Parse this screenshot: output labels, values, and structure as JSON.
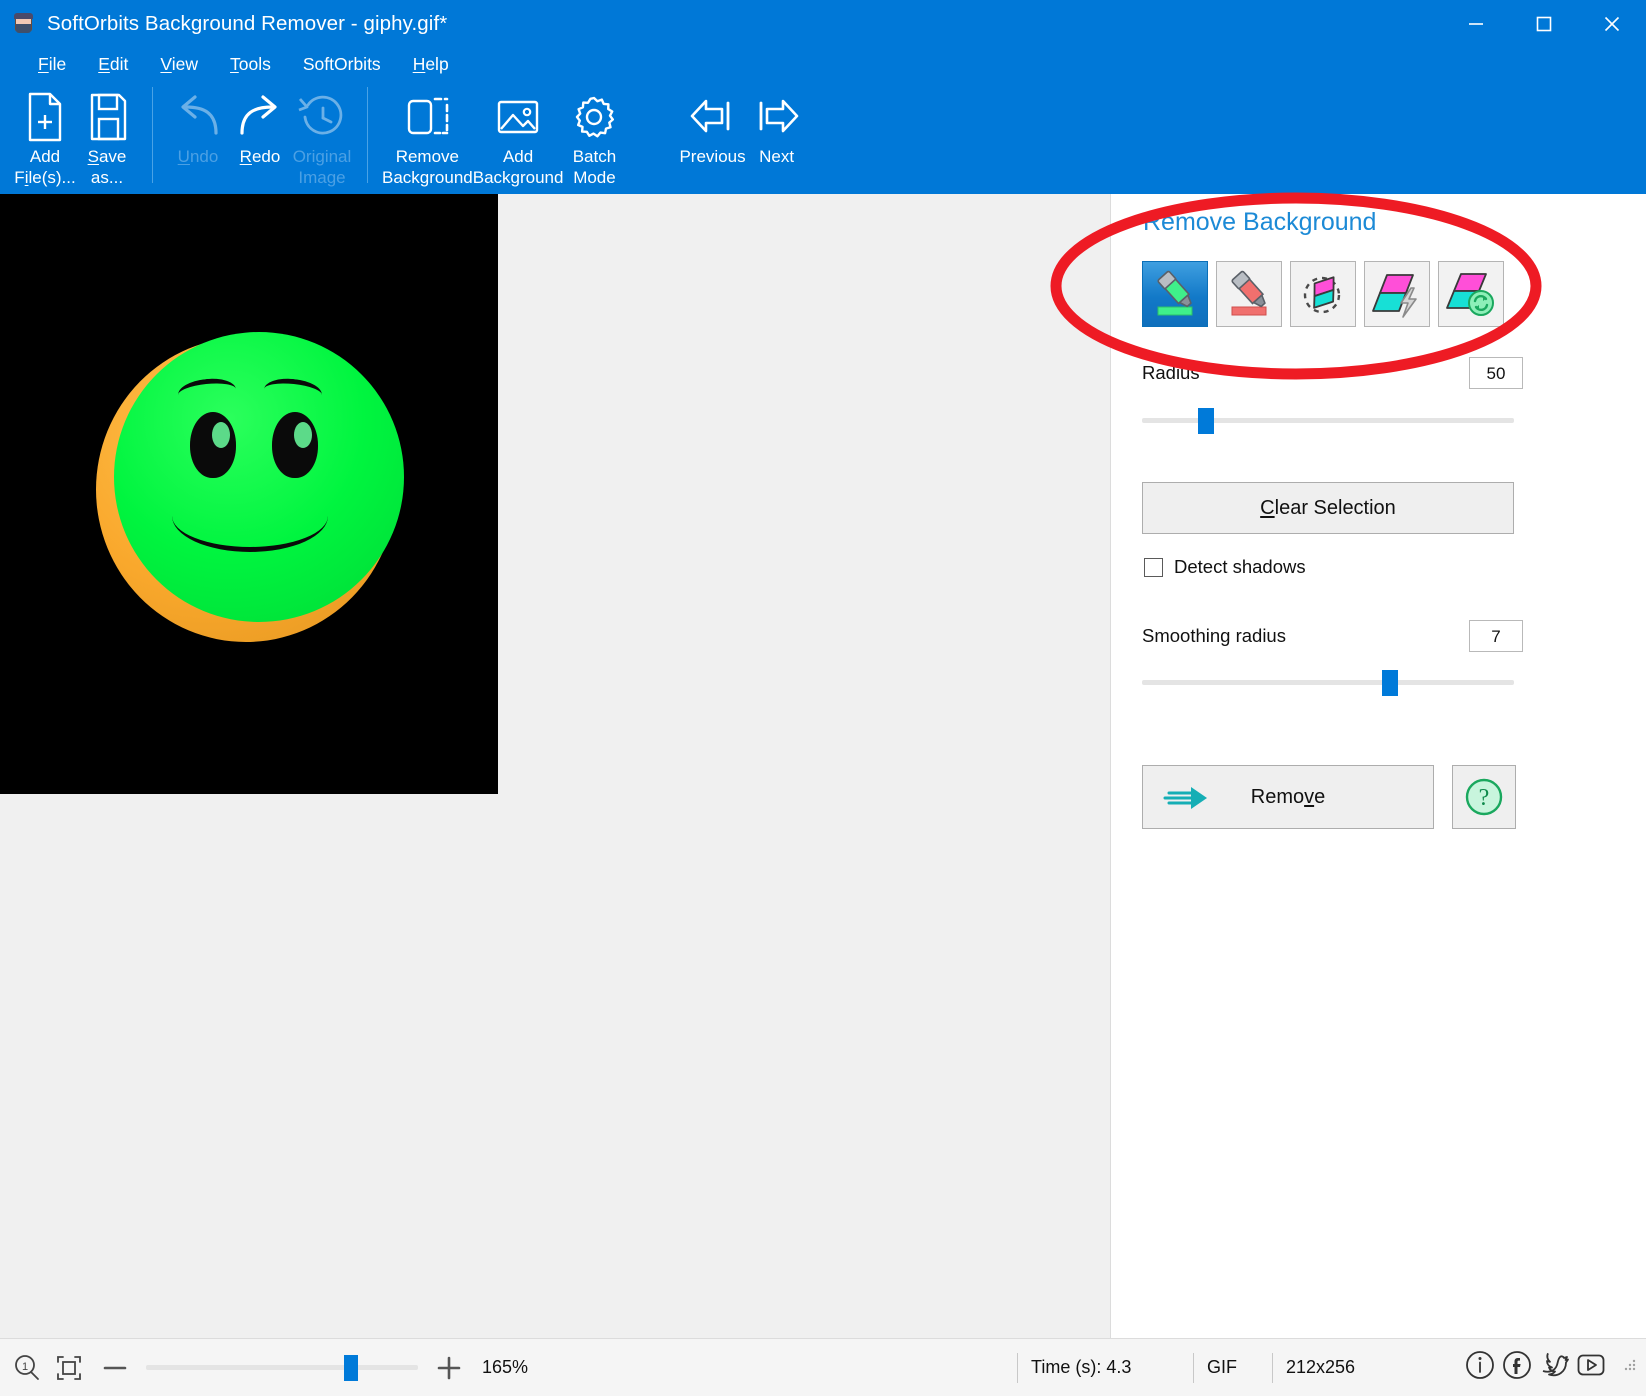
{
  "window": {
    "title": "SoftOrbits Background Remover - giphy.gif*",
    "app_icon": "app-logo-icon",
    "controls": {
      "minimize": "minimize-icon",
      "maximize": "maximize-icon",
      "close": "close-icon"
    }
  },
  "menu": {
    "items": [
      {
        "label": "File",
        "accel": "F"
      },
      {
        "label": "Edit",
        "accel": "E"
      },
      {
        "label": "View",
        "accel": "V"
      },
      {
        "label": "Tools",
        "accel": "T"
      },
      {
        "label": "SoftOrbits",
        "accel": ""
      },
      {
        "label": "Help",
        "accel": "H"
      }
    ]
  },
  "toolbar": {
    "buttons": [
      {
        "name": "add-files",
        "line1": "Add",
        "line2": "File(s)...",
        "accel": "i",
        "icon": "document-add-icon",
        "disabled": false
      },
      {
        "name": "save-as",
        "line1": "Save",
        "line2": "as...",
        "accel": "S",
        "icon": "floppy-save-icon",
        "disabled": false
      },
      {
        "name": "undo",
        "line1": "Undo",
        "line2": "",
        "accel": "U",
        "icon": "undo-arrow-icon",
        "disabled": true
      },
      {
        "name": "redo",
        "line1": "Redo",
        "line2": "",
        "accel": "R",
        "icon": "redo-arrow-icon",
        "disabled": false
      },
      {
        "name": "original-image",
        "line1": "Original",
        "line2": "Image",
        "accel": "",
        "icon": "clock-history-icon",
        "disabled": true
      },
      {
        "name": "remove-background",
        "line1": "Remove",
        "line2": "Background",
        "accel": "",
        "icon": "crop-dashed-icon",
        "disabled": false
      },
      {
        "name": "add-background",
        "line1": "Add",
        "line2": "Background",
        "accel": "",
        "icon": "picture-icon",
        "disabled": false
      },
      {
        "name": "batch-mode",
        "line1": "Batch",
        "line2": "Mode",
        "accel": "",
        "icon": "gear-icon",
        "disabled": false
      },
      {
        "name": "previous",
        "line1": "Previous",
        "line2": "",
        "accel": "",
        "icon": "arrow-left-icon",
        "disabled": false
      },
      {
        "name": "next",
        "line1": "Next",
        "line2": "",
        "accel": "",
        "icon": "arrow-right-icon",
        "disabled": false
      }
    ]
  },
  "panel": {
    "title": "Remove Background",
    "tools": [
      {
        "name": "tool-mark-keep",
        "icon": "green-marker-icon",
        "selected": true
      },
      {
        "name": "tool-mark-remove",
        "icon": "red-marker-icon",
        "selected": false
      },
      {
        "name": "tool-eraser",
        "icon": "dashed-eraser-icon",
        "selected": false
      },
      {
        "name": "tool-magic-wand",
        "icon": "layers-lightning-icon",
        "selected": false
      },
      {
        "name": "tool-auto-refresh",
        "icon": "layers-refresh-icon",
        "selected": false
      }
    ],
    "radius": {
      "label": "Radius",
      "value": "50",
      "slider_percent": 17
    },
    "clear_selection": {
      "label": "Clear Selection",
      "accel": "C"
    },
    "detect_shadows": {
      "label": "Detect shadows",
      "checked": false
    },
    "smoothing_radius": {
      "label": "Smoothing radius",
      "value": "7",
      "slider_percent": 65
    },
    "remove": {
      "label": "Remove",
      "accel": "v",
      "icon": "remove-arrow-icon"
    },
    "help": {
      "icon": "help-question-icon"
    }
  },
  "annotation": {
    "shape": "red-ellipse-highlight",
    "color": "#ee1b24"
  },
  "canvas": {
    "image_name": "giphy.gif",
    "background_color": "#000000",
    "subject": "green-smiley-face"
  },
  "statusbar": {
    "zoom_out_icon": "minus-icon",
    "zoom_in_icon": "plus-icon",
    "fit_icon": "fit-to-screen-icon",
    "magnifier_icon": "magnifier-one-to-one-icon",
    "zoom_percent": "165%",
    "zoom_slider_percent": 73,
    "time_label": "Time (s): 4.3",
    "format_label": "GIF",
    "dimensions_label": "212x256",
    "social": [
      {
        "name": "info-icon",
        "glyph": "i"
      },
      {
        "name": "facebook-icon",
        "glyph": "f"
      },
      {
        "name": "twitter-icon",
        "glyph": "t"
      },
      {
        "name": "youtube-icon",
        "glyph": "y"
      }
    ]
  },
  "colors": {
    "accent": "#0078d7",
    "panel_title": "#1c8ad6",
    "annotation_red": "#ee1b24",
    "slider_thumb": "#007ad9"
  }
}
